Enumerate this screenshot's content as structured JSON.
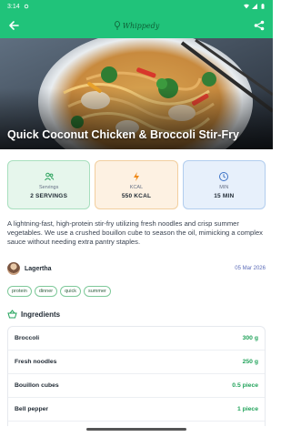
{
  "status_bar": {
    "time": "3:14"
  },
  "app_bar": {
    "logo_text": "Whippedy"
  },
  "recipe": {
    "title": "Quick Coconut Chicken & Broccoli Stir-Fry",
    "stats": [
      {
        "label": "Servings",
        "value": "2 SERVINGS",
        "icon": "people-icon",
        "color": "#2ea45f"
      },
      {
        "label": "KCAL",
        "value": "550 KCAL",
        "icon": "flame-icon",
        "color": "#ef8a1a"
      },
      {
        "label": "MIN",
        "value": "15 MIN",
        "icon": "clock-icon",
        "color": "#3e73c6"
      }
    ],
    "description": "A lightning-fast, high-protein stir-fry utilizing fresh noodles and crisp summer vegetables. We use a crushed bouillon cube to season the oil, mimicking a complex sauce without needing extra pantry staples.",
    "author": {
      "name": "Lagertha",
      "date": "05 Mar 2026"
    },
    "tags": [
      "protein",
      "dinner",
      "quick",
      "summer"
    ],
    "ingredients_title": "Ingredients",
    "ingredients": [
      {
        "name": "Broccoli",
        "qty": "300 g"
      },
      {
        "name": "Fresh noodles",
        "qty": "250 g"
      },
      {
        "name": "Bouillon cubes",
        "qty": "0.5 piece"
      },
      {
        "name": "Bell pepper",
        "qty": "1 piece"
      }
    ]
  },
  "colors": {
    "primary": "#20c37a",
    "accent_green": "#22a35b"
  }
}
